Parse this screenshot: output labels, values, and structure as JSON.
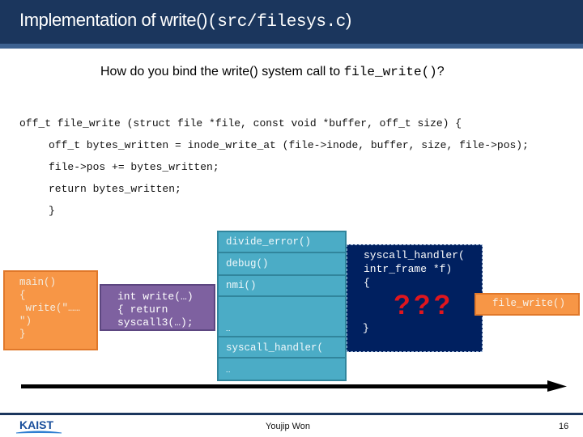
{
  "title": {
    "text": "Implementation of write()",
    "code": "(src/filesys.c",
    "suffix": ")"
  },
  "question": {
    "text": "How do you bind the write() system call to ",
    "code": "file_write()",
    "suffix": "?"
  },
  "code_listing": [
    "off_t file_write (struct file *file, const void *buffer, off_t size) {",
    "off_t bytes_written = inode_write_at (file->inode, buffer, size, file->pos);",
    "file->pos += bytes_written;",
    "return bytes_written;",
    "}"
  ],
  "diagram": {
    "main_box": "main()\n{\n write(\"……\n\")\n}",
    "write_box": "int write(…)\n{ return\nsyscall3(…);\n}",
    "idt_entries": [
      "divide_error()",
      "debug()",
      "nmi()",
      "…",
      "syscall_handler(",
      "…"
    ],
    "handler_box": "syscall_handler(\nintr_frame *f)\n{",
    "handler_close": "}",
    "question_marks": "???",
    "file_write_box": "file_write()"
  },
  "colors": {
    "title_bar": "#1b365d",
    "orange": "#f79646",
    "purple": "#7e61a0",
    "teal": "#4bacc6",
    "navy": "#002060",
    "red": "#e0161e"
  },
  "footer": {
    "logo": "KAIST",
    "author": "Youjip Won",
    "page": "16"
  }
}
